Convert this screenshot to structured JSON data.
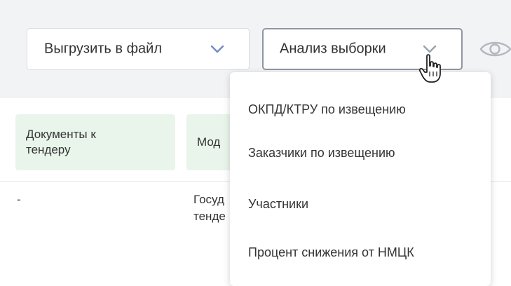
{
  "toolbar": {
    "export_label": "Выгрузить в файл",
    "analysis_label": "Анализ выборки"
  },
  "table": {
    "headers": [
      "Документы к\nтендеру",
      "Мод"
    ],
    "row": {
      "docs": "-",
      "model": "Госуд\nтенде"
    }
  },
  "dropdown": {
    "items": [
      "ОКПД/КТРУ по извещению",
      "Заказчики по извещению",
      "Участники",
      "Процент снижения от НМЦК"
    ]
  },
  "icons": {
    "export_chevron": "chevron-down-icon",
    "analysis_chevron": "chevron-down-icon",
    "eye": "eye-icon",
    "cursor": "hand-pointer-icon"
  },
  "colors": {
    "toolbar_bg": "#f2f3f5",
    "header_bg": "#e9f5ea",
    "chevron": "#6f8fbf",
    "border_active": "#8f96a3"
  }
}
